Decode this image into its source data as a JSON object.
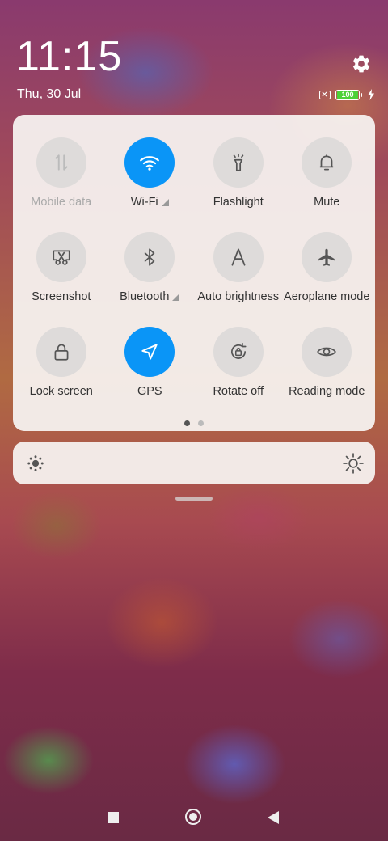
{
  "status": {
    "time": "11:15",
    "date": "Thu, 30 Jul",
    "battery_level": "100",
    "charging": true
  },
  "colors": {
    "accent": "#0a95f7",
    "tile_inactive": "#dedbda",
    "battery_green": "#4cd137"
  },
  "quick_settings": {
    "tiles": [
      {
        "label": "Mobile data",
        "icon": "mobile-data-icon",
        "active": false,
        "disabled": true,
        "has_more": false
      },
      {
        "label": "Wi-Fi",
        "icon": "wifi-icon",
        "active": true,
        "disabled": false,
        "has_more": true
      },
      {
        "label": "Flashlight",
        "icon": "flashlight-icon",
        "active": false,
        "disabled": false,
        "has_more": false
      },
      {
        "label": "Mute",
        "icon": "bell-icon",
        "active": false,
        "disabled": false,
        "has_more": false
      },
      {
        "label": "Screenshot",
        "icon": "scissors-icon",
        "active": false,
        "disabled": false,
        "has_more": false
      },
      {
        "label": "Bluetooth",
        "icon": "bluetooth-icon",
        "active": false,
        "disabled": false,
        "has_more": true
      },
      {
        "label": "Auto brightness",
        "icon": "auto-brightness-icon",
        "active": false,
        "disabled": false,
        "has_more": false
      },
      {
        "label": "Aeroplane mode",
        "icon": "airplane-icon",
        "active": false,
        "disabled": false,
        "has_more": false
      },
      {
        "label": "Lock screen",
        "icon": "lock-icon",
        "active": false,
        "disabled": false,
        "has_more": false
      },
      {
        "label": "GPS",
        "icon": "location-icon",
        "active": true,
        "disabled": false,
        "has_more": false
      },
      {
        "label": "Rotate off",
        "icon": "rotation-lock-icon",
        "active": false,
        "disabled": false,
        "has_more": false
      },
      {
        "label": "Reading mode",
        "icon": "eye-icon",
        "active": false,
        "disabled": false,
        "has_more": false
      }
    ],
    "current_page": 1,
    "page_count": 2
  },
  "brightness": {
    "level_fraction": 0.0
  }
}
